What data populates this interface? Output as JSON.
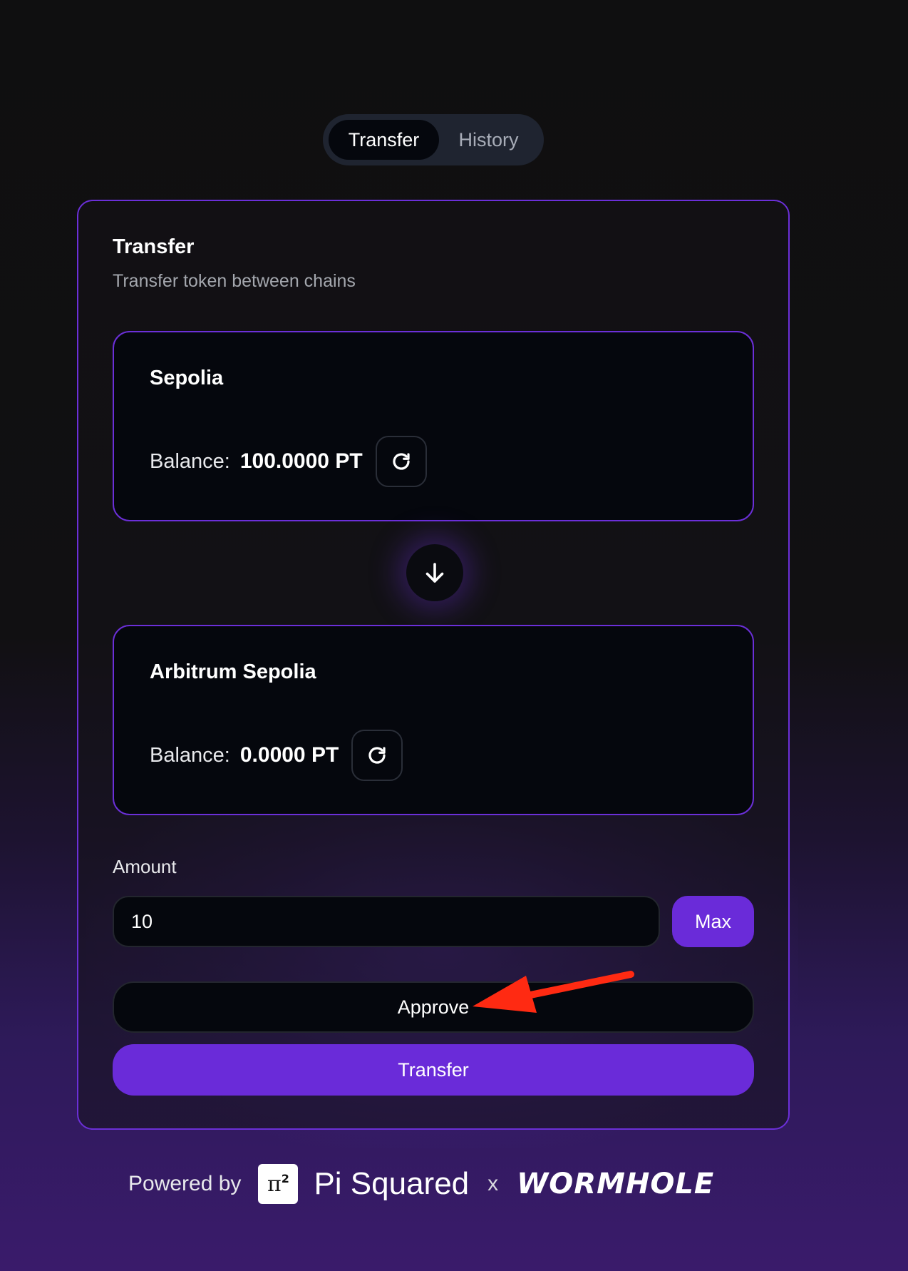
{
  "tabs": {
    "transfer": "Transfer",
    "history": "History",
    "active": "Transfer"
  },
  "card": {
    "title": "Transfer",
    "subtitle": "Transfer token between chains",
    "source": {
      "chain": "Sepolia",
      "balance_label": "Balance:",
      "balance_value": "100.0000 PT"
    },
    "destination": {
      "chain": "Arbitrum Sepolia",
      "balance_label": "Balance:",
      "balance_value": "0.0000 PT"
    },
    "amount_label": "Amount",
    "amount_value": "10",
    "max_label": "Max",
    "approve_label": "Approve",
    "transfer_label": "Transfer"
  },
  "footer": {
    "powered_by": "Powered by",
    "pi_logo_text": "π²",
    "pi_name": "Pi Squared",
    "separator": "x",
    "wormhole": "WORMHOLE"
  },
  "icons": {
    "refresh": "refresh-icon",
    "swap": "arrow-down-icon",
    "annotation": "red-arrow-annotation"
  },
  "colors": {
    "accent": "#6a2bd9",
    "card_border": "#6b2fd8",
    "annotation_arrow": "#ff2a12"
  }
}
